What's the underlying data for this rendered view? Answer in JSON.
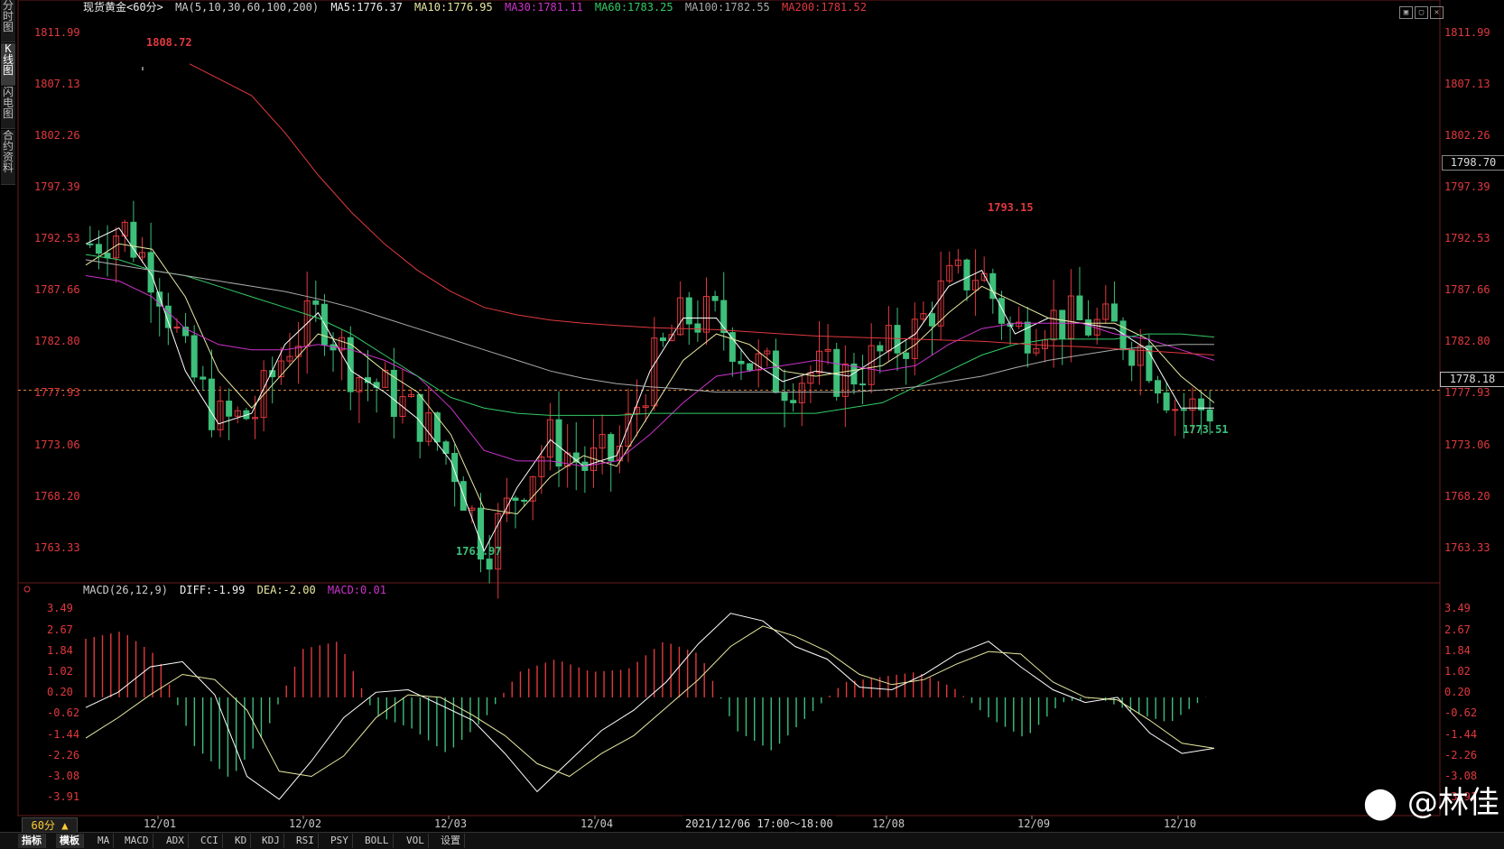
{
  "sidebar": {
    "tabs": [
      {
        "label": "分\n时\n图",
        "active": false
      },
      {
        "label": "K\n线\n图",
        "active": true
      },
      {
        "label": "闪\n电\n图",
        "active": false
      },
      {
        "label": "合\n约\n资\n料",
        "active": false
      }
    ]
  },
  "legend": {
    "instrument": "现货黄金<60分>",
    "ma_params": "MA(5,10,30,60,100,200)",
    "ma5": "MA5:1776.37",
    "ma10": "MA10:1776.95",
    "ma30": "MA30:1781.11",
    "ma60": "MA60:1783.25",
    "ma100": "MA100:1782.55",
    "ma200": "MA200:1781.52"
  },
  "macd_legend": {
    "params": "MACD(26,12,9)",
    "diff": "DIFF:-1.99",
    "dea": "DEA:-2.00",
    "macd": "MACD:0.01"
  },
  "price_axis": [
    "1811.99",
    "1807.13",
    "1802.26",
    "1797.39",
    "1792.53",
    "1787.66",
    "1782.80",
    "1777.93",
    "1773.06",
    "1768.20",
    "1763.33"
  ],
  "macd_axis": [
    "3.49",
    "2.67",
    "1.84",
    "1.02",
    "0.20",
    "-0.62",
    "-1.44",
    "-2.26",
    "-3.08",
    "-3.91"
  ],
  "dates": [
    "12/01",
    "12/02",
    "12/03",
    "12/04",
    "12/08",
    "12/09",
    "12/10"
  ],
  "peaks": {
    "high1": "1808.72",
    "high2": "1793.15",
    "low1": "1761.97",
    "low2": "1773.51"
  },
  "current_price": "1778.18",
  "last_price": "1798.70",
  "time_hover": "2021/12/06 17:00～18:00",
  "period_label": "60分 ▲",
  "bottom_tabs": [
    "指标",
    "模板",
    "MA",
    "MACD",
    "ADX",
    "CCI",
    "KD",
    "KDJ",
    "RSI",
    "PSY",
    "BOLL",
    "VOL",
    "设置"
  ],
  "watermark": "@林佳",
  "colors": {
    "up": "#e0393e",
    "down": "#3dbf7a",
    "ma5": "#ffffff",
    "ma10": "#e8e8a0",
    "ma30": "#cc33cc",
    "ma60": "#33cc66",
    "ma100": "#aaaaaa",
    "ma200": "#e0393e"
  },
  "chart_data": [
    {
      "type": "candlestick",
      "title": "现货黄金<60分>",
      "ylim": [
        1760.5,
        1813.5
      ],
      "x": [
        "12/01",
        "12/02",
        "12/03",
        "12/04",
        "12/08",
        "12/09",
        "12/10"
      ],
      "series": [
        {
          "name": "MA5",
          "values": [
            1792.0,
            1793.5,
            1789.0,
            1780.0,
            1775.0,
            1776.0,
            1782.5,
            1785.5,
            1780.0,
            1778.0,
            1775.5,
            1771.5,
            1763.0,
            1769.0,
            1773.5,
            1771.0,
            1772.0,
            1780.0,
            1785.0,
            1785.0,
            1781.0,
            1779.0,
            1780.0,
            1779.5,
            1781.5,
            1783.5,
            1788.0,
            1789.5,
            1783.5,
            1785.0,
            1784.5,
            1784.0,
            1782.0,
            1776.5,
            1776.5
          ]
        },
        {
          "name": "MA10",
          "values": [
            1790.0,
            1792.0,
            1791.5,
            1787.0,
            1780.0,
            1776.5,
            1780.0,
            1783.5,
            1782.5,
            1780.0,
            1778.0,
            1774.0,
            1767.0,
            1766.5,
            1770.0,
            1772.0,
            1771.0,
            1776.0,
            1781.0,
            1783.5,
            1782.5,
            1780.0,
            1779.5,
            1780.0,
            1780.5,
            1782.5,
            1785.5,
            1788.0,
            1786.5,
            1785.0,
            1784.5,
            1784.5,
            1783.0,
            1779.5,
            1777.0
          ]
        },
        {
          "name": "MA30",
          "values": [
            1789.0,
            1788.5,
            1787.0,
            1784.0,
            1782.5,
            1782.0,
            1782.0,
            1782.5,
            1782.0,
            1781.0,
            1779.5,
            1776.5,
            1772.5,
            1771.5,
            1771.5,
            1771.0,
            1771.5,
            1774.0,
            1777.0,
            1779.5,
            1780.0,
            1780.5,
            1781.0,
            1780.5,
            1780.0,
            1780.5,
            1782.5,
            1784.0,
            1784.5,
            1784.5,
            1784.5,
            1783.5,
            1783.0,
            1782.0,
            1781.0
          ]
        },
        {
          "name": "MA60",
          "values": [
            1791.0,
            1790.5,
            1789.5,
            1789.0,
            1788.0,
            1787.0,
            1786.0,
            1785.0,
            1783.5,
            1781.5,
            1779.5,
            1777.5,
            1776.5,
            1776.0,
            1775.8,
            1775.8,
            1775.8,
            1776.0,
            1776.0,
            1776.0,
            1776.0,
            1776.0,
            1776.0,
            1776.5,
            1777.0,
            1778.5,
            1780.0,
            1781.5,
            1782.5,
            1783.0,
            1783.0,
            1783.0,
            1783.5,
            1783.5,
            1783.2
          ]
        },
        {
          "name": "MA100",
          "values": [
            1790.5,
            1790.0,
            1789.5,
            1789.0,
            1788.5,
            1788.0,
            1787.5,
            1786.8,
            1786.0,
            1785.0,
            1784.0,
            1783.0,
            1782.0,
            1781.0,
            1780.0,
            1779.3,
            1778.8,
            1778.5,
            1778.3,
            1778.0,
            1778.0,
            1778.0,
            1778.0,
            1778.0,
            1778.2,
            1778.5,
            1779.0,
            1779.5,
            1780.3,
            1781.0,
            1781.5,
            1782.0,
            1782.3,
            1782.5,
            1782.5
          ]
        },
        {
          "name": "MA200",
          "values": [
            null,
            null,
            null,
            null,
            1809.0,
            1806.0,
            1802.5,
            1798.5,
            1795.0,
            1792.0,
            1789.5,
            1787.5,
            1786.0,
            1785.3,
            1784.8,
            1784.5,
            1784.3,
            1784.1,
            1784.0,
            1783.9,
            1783.7,
            1783.5,
            1783.3,
            1783.2,
            1783.1,
            1783.0,
            1782.9,
            1782.8,
            1782.6,
            1782.4,
            1782.3,
            1782.1,
            1781.9,
            1781.7,
            1781.5
          ]
        }
      ]
    },
    {
      "type": "bar",
      "title": "MACD(26,12,9)",
      "ylim": [
        -4.5,
        4.0
      ],
      "series": [
        {
          "name": "DIFF",
          "values": [
            -0.4,
            0.2,
            1.2,
            1.4,
            0.1,
            -3.1,
            -4.0,
            -2.5,
            -0.8,
            0.2,
            0.3,
            -0.3,
            -0.9,
            -2.2,
            -3.7,
            -2.5,
            -1.3,
            -0.5,
            0.6,
            2.1,
            3.3,
            3.0,
            2.0,
            1.5,
            0.4,
            0.3,
            0.9,
            1.7,
            2.2,
            1.2,
            0.3,
            -0.2,
            0.0,
            -1.4,
            -2.2,
            -2.0
          ]
        },
        {
          "name": "DEA",
          "values": [
            -1.6,
            -0.8,
            0.1,
            0.9,
            0.7,
            -0.5,
            -2.9,
            -3.1,
            -2.3,
            -0.8,
            0.1,
            0.0,
            -0.7,
            -1.5,
            -2.6,
            -3.1,
            -2.2,
            -1.5,
            -0.4,
            0.7,
            2.0,
            2.8,
            2.4,
            1.8,
            0.9,
            0.5,
            0.7,
            1.3,
            1.8,
            1.7,
            0.6,
            0.0,
            -0.1,
            -0.9,
            -1.8,
            -2.0
          ]
        },
        {
          "name": "MACD",
          "values": [
            2.3,
            2.6,
            1.6,
            -1.9,
            -3.2,
            -1.3,
            1.9,
            2.2,
            -0.7,
            -1.2,
            -2.2,
            -0.9,
            1.0,
            1.5,
            1.0,
            1.1,
            2.2,
            1.7,
            -1.3,
            -2.1,
            -0.7,
            0.6,
            0.8,
            1.0,
            0.4,
            -0.8,
            -1.6,
            -0.2,
            0.0,
            -0.6,
            -1.0,
            0.01
          ]
        }
      ]
    }
  ]
}
